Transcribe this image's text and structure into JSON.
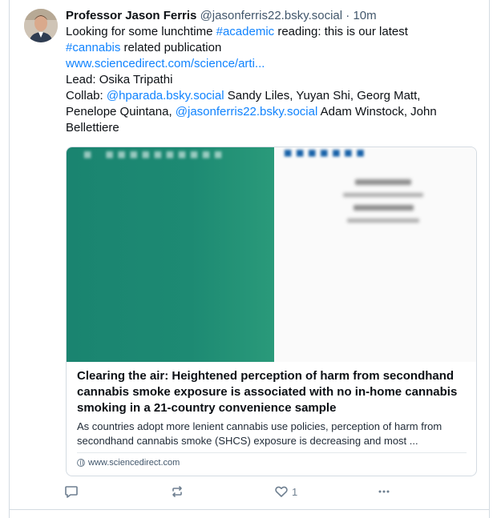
{
  "author": {
    "name": "Professor Jason Ferris",
    "handle": "@jasonferris22.bsky.social",
    "separator": "·",
    "time": "10m"
  },
  "post": {
    "line1": {
      "pre": "Looking for some lunchtime ",
      "tag1": "#academic",
      "post": " reading: this is our latest"
    },
    "line2": {
      "tag2": "#cannabis",
      "post": " related publication"
    },
    "url": "www.sciencedirect.com/science/arti...",
    "lead": "Lead: Osika Tripathi",
    "collab": {
      "pre": "Collab: ",
      "mention1": "@hparada.bsky.social",
      "mid1": " Sandy Liles, Yuyan Shi, Georg Matt,",
      "line2_pre": "Penelope Quintana, ",
      "mention2": "@jasonferris22.bsky.social",
      "line2_post": " Adam Winstock, John",
      "line3": "Bellettiere"
    }
  },
  "card": {
    "title": "Clearing the air: Heightened perception of harm from secondhand cannabis smoke exposure is associated with no in-home cannabis smoking in a 21-country convenience sample",
    "description": "As countries adopt more lenient cannabis use policies, perception of harm from secondhand cannabis smoke (SHCS) exposure is decreasing and most ...",
    "domain": "www.sciencedirect.com"
  },
  "actions": {
    "reply_icon": "reply-icon",
    "repost_icon": "repost-icon",
    "like_icon": "heart-icon",
    "like_count": "1",
    "more_icon": "more-icon"
  },
  "colors": {
    "link": "#1083fe",
    "muted": "#42576c",
    "border": "#d4dbe2",
    "thumb_green": "#1d8a73"
  }
}
